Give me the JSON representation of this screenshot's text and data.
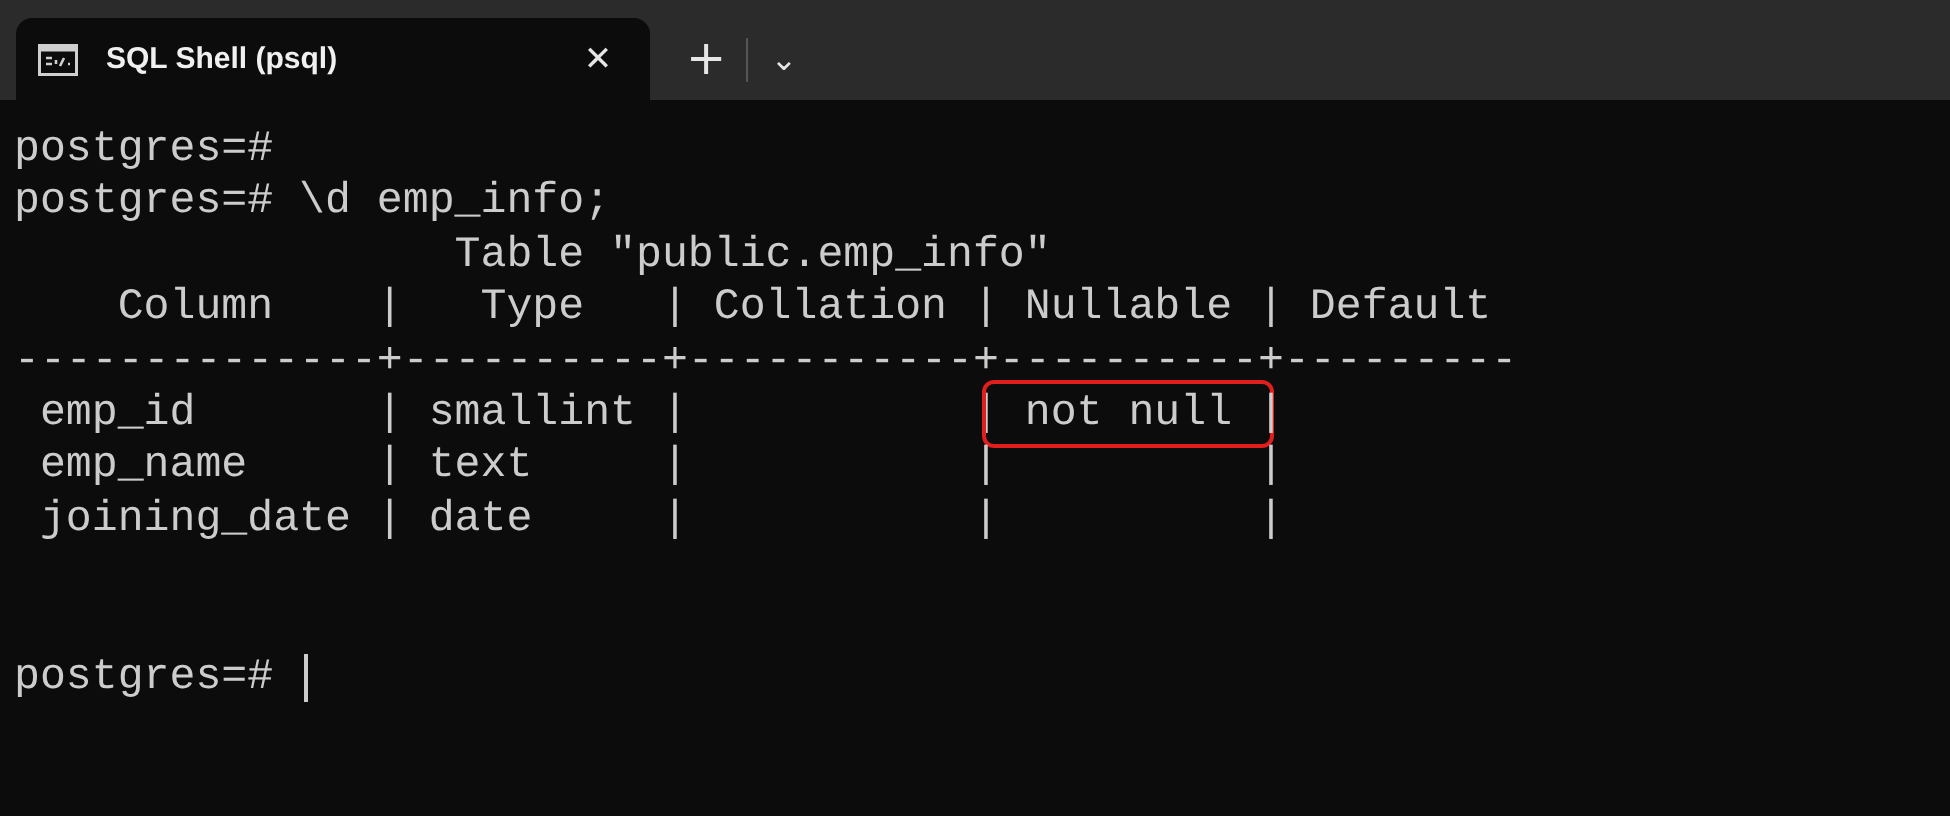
{
  "tabs": [
    {
      "title": "SQL Shell (psql)",
      "selected": true,
      "close": "✕"
    }
  ],
  "new_tab": "+",
  "dropdown": "⌄",
  "terminal": {
    "lines": [
      {
        "segments": [
          {
            "text": "postgres=#",
            "highlighted": false
          }
        ]
      },
      {
        "segments": [
          {
            "text": "postgres=# \\d emp_info;",
            "highlighted": false
          }
        ]
      },
      {
        "segments": [
          {
            "text": "                 Table \"public.emp_info\"",
            "highlighted": false
          }
        ]
      },
      {
        "segments": [
          {
            "text": "    Column    |   Type   | Collation | Nullable | Default",
            "highlighted": false
          }
        ]
      },
      {
        "segments": [
          {
            "text": "--------------+----------+-----------+----------+---------",
            "highlighted": false
          }
        ]
      },
      {
        "segments": [
          {
            "text": " emp_id       | smallint |           |",
            "highlighted": false
          },
          {
            "text": " not null ",
            "highlighted": true
          },
          {
            "text": "|",
            "highlighted": false
          }
        ]
      },
      {
        "segments": [
          {
            "text": " emp_name     | text     |           |          |",
            "highlighted": false
          }
        ]
      },
      {
        "segments": [
          {
            "text": " joining_date | date     |           |          |",
            "highlighted": false
          }
        ]
      }
    ],
    "prompt": {
      "text": "postgres=# ",
      "cursor": true
    }
  }
}
